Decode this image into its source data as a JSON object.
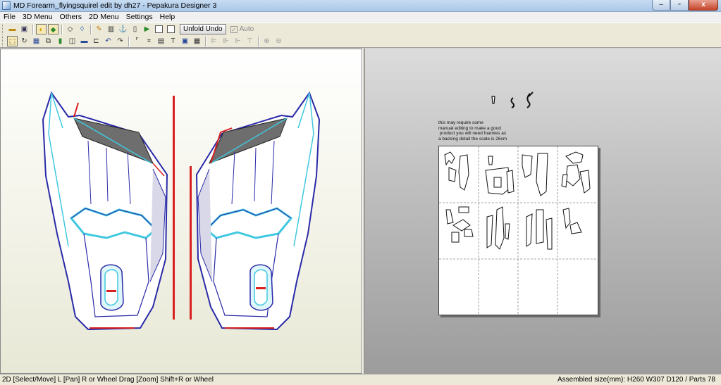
{
  "window": {
    "title": "MD Forearm_flyingsquirel edit by dh27 - Pepakura Designer 3",
    "controls": [
      "–",
      "▫",
      "x"
    ]
  },
  "menubar": {
    "items": [
      "File",
      "3D Menu",
      "Others",
      "2D Menu",
      "Settings",
      "Help"
    ]
  },
  "toolbar": {
    "unfold_undo_label": "Unfold Undo",
    "auto_label": "Auto",
    "auto_checked": true
  },
  "sheet_note": {
    "lines": [
      "this may require some",
      "manual editing to make a good",
      " product you will need foamies as",
      "a backing detail the scale is 26cm"
    ]
  },
  "status": {
    "left": "2D [Select/Move] L [Pan] R or Wheel Drag [Zoom] Shift+R or Wheel",
    "right": "Assembled size(mm): H260 W307 D120 / Parts 78"
  },
  "colors": {
    "title_bar": "#a9c6e8",
    "model_outline": "#2a2aa8",
    "model_fold": "#40c8e0",
    "model_cut_edge": "#d82020",
    "model_shade": "#6e6e6e"
  }
}
